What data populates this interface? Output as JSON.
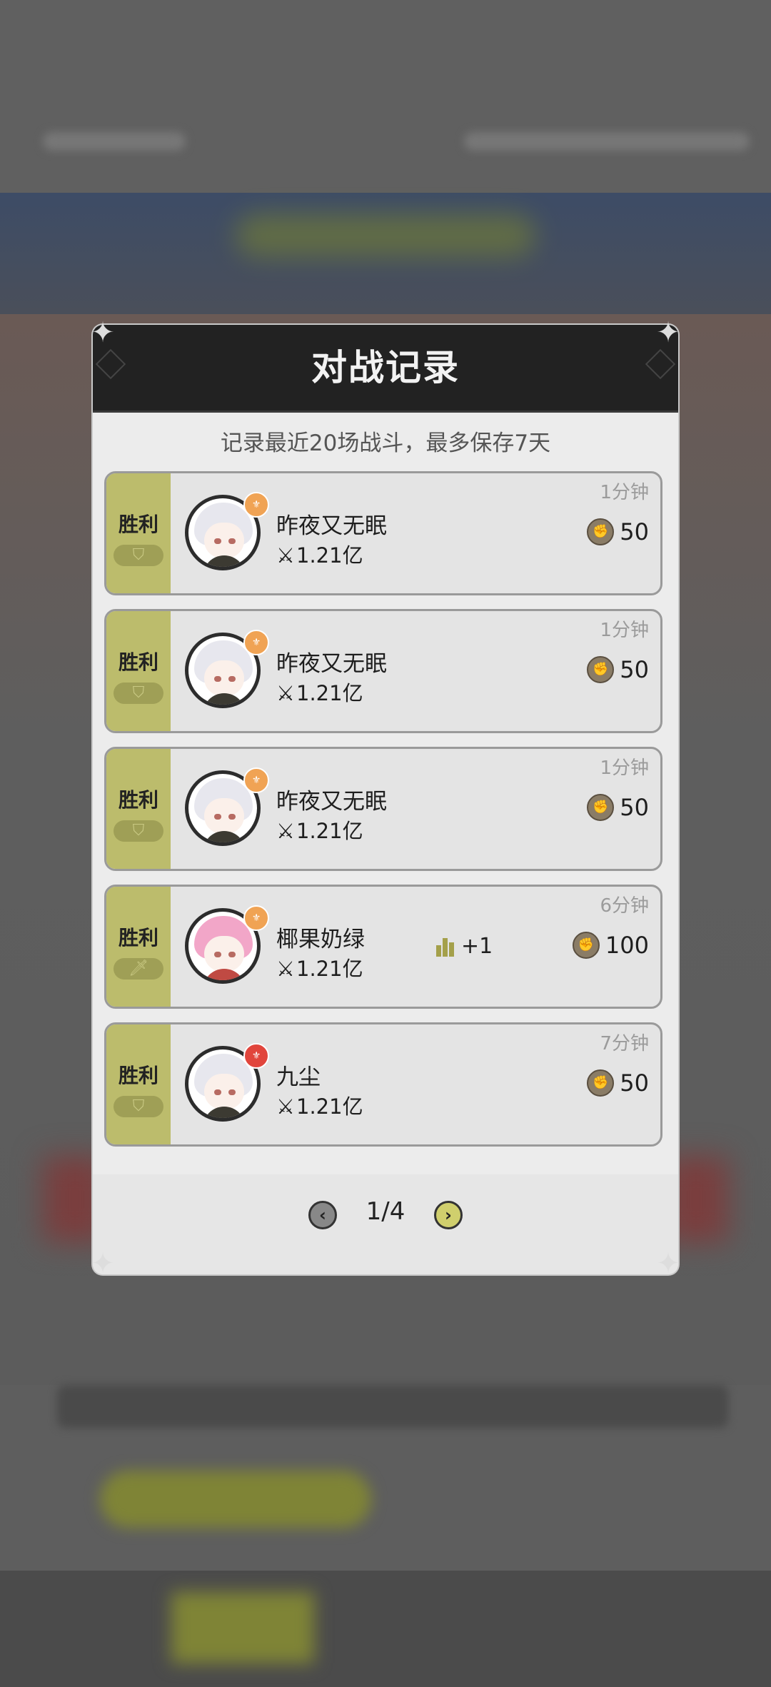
{
  "modal": {
    "title": "对战记录",
    "subtitle": "记录最近20场战斗，最多保存7天"
  },
  "records": [
    {
      "result": "胜利",
      "badge_icon": "shield-icon",
      "name": "昨夜又无眠",
      "power": "1.21亿",
      "time_ago": "1分钟",
      "reward": "50",
      "rank_change": ""
    },
    {
      "result": "胜利",
      "badge_icon": "shield-icon",
      "name": "昨夜又无眠",
      "power": "1.21亿",
      "time_ago": "1分钟",
      "reward": "50",
      "rank_change": ""
    },
    {
      "result": "胜利",
      "badge_icon": "shield-icon",
      "name": "昨夜又无眠",
      "power": "1.21亿",
      "time_ago": "1分钟",
      "reward": "50",
      "rank_change": ""
    },
    {
      "result": "胜利",
      "badge_icon": "sword-icon",
      "name": "椰果奶绿",
      "power": "1.21亿",
      "time_ago": "6分钟",
      "reward": "100",
      "rank_change": "+1"
    },
    {
      "result": "胜利",
      "badge_icon": "shield-icon",
      "name": "九尘",
      "power": "1.21亿",
      "time_ago": "7分钟",
      "reward": "50",
      "rank_change": ""
    }
  ],
  "pagination": {
    "current": "1/4"
  },
  "colors": {
    "win_panel": "#bcbc6c",
    "header_bg": "#222222",
    "next_button": "#d0cf6d"
  }
}
